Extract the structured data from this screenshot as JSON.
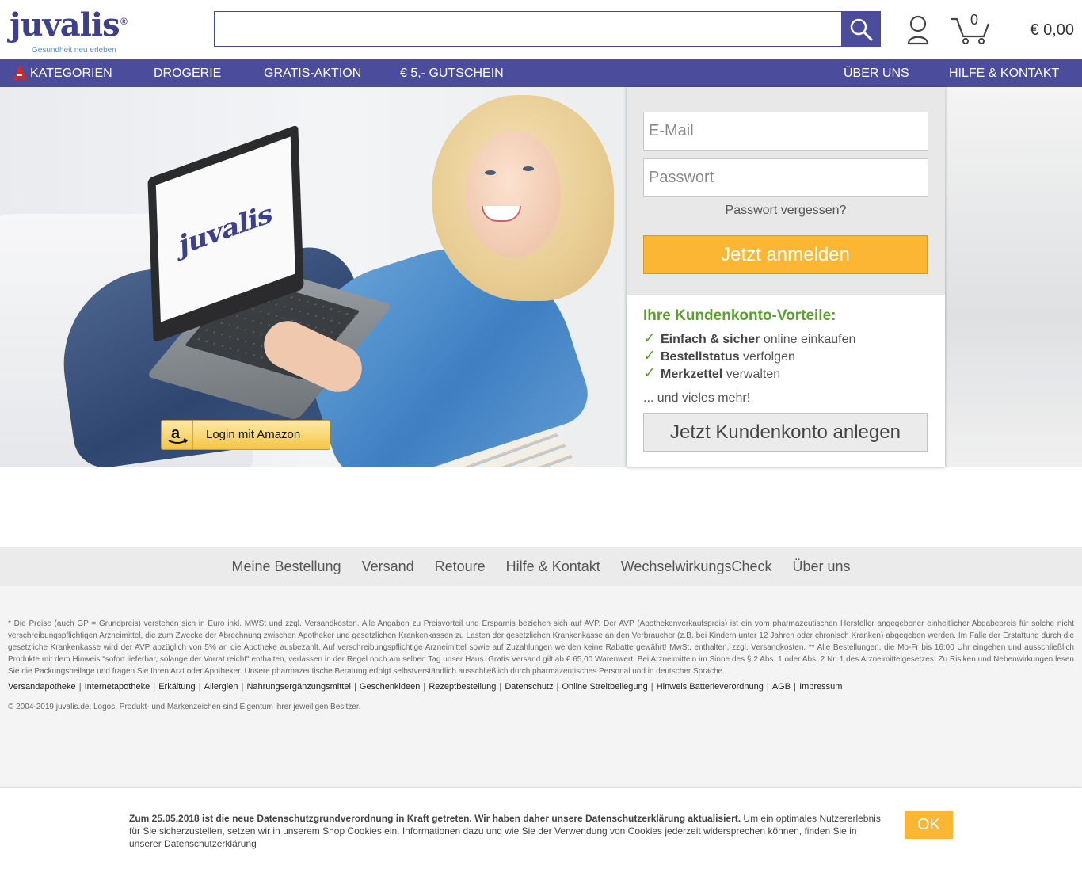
{
  "header": {
    "logo_text": "juvalis",
    "logo_registered": "®",
    "logo_tagline": "Gesundheit neu erleben",
    "search": {
      "value": "",
      "placeholder": ""
    },
    "cart_count": "0",
    "cart_total": "€ 0,00"
  },
  "nav": {
    "items": [
      {
        "label": "Kategorien"
      },
      {
        "label": "Drogerie"
      },
      {
        "label": "Gratis-Aktion"
      },
      {
        "label": "€ 5,- Gutschein"
      },
      {
        "label": "Über uns"
      },
      {
        "label": "Hilfe & Kontakt"
      }
    ]
  },
  "hero": {
    "laptop_logo": "juvalis",
    "amazon_login": "Login mit Amazon"
  },
  "login": {
    "email_placeholder": "E-Mail",
    "password_placeholder": "Passwort",
    "forgot": "Passwort vergessen?",
    "submit": "Jetzt anmelden",
    "benefits_title": "Ihre Kundenkonto-Vorteile:",
    "benefits": [
      {
        "bold": "Einfach & sicher",
        "rest": " online einkaufen"
      },
      {
        "bold": "Bestellstatus",
        "rest": " verfolgen"
      },
      {
        "bold": "Merkzettel",
        "rest": " verwalten"
      }
    ],
    "more": "... und vieles mehr!",
    "register": "Jetzt Kundenkonto anlegen"
  },
  "footer": {
    "links": [
      "Meine Bestellung",
      "Versand",
      "Retoure",
      "Hilfe & Kontakt",
      "WechselwirkungsCheck",
      "Über uns"
    ],
    "legal_text": "* Die Preise (auch GP = Grundpreis) verstehen sich in Euro inkl. MWSt und zzgl. Versandkosten. Alle Angaben zu Preisvorteil und Ersparnis beziehen sich auf AVP. Der AVP (Apothekenverkaufspreis) ist ein vom pharmazeutischen Hersteller angegebener einheitlicher Abgabepreis für solche nicht verschreibungspflichtigen Arzneimittel, die zum Zwecke der Abrechnung zwischen Apotheker und gesetzlichen Krankenkassen zu Lasten der gesetzlichen Krankenkasse an den Verbraucher (z.B. bei Kindern unter 12 Jahren oder chronisch Kranken) abgegeben werden. Im Falle der Erstattung durch die gesetzliche Krankenkasse wird der AVP abzüglich von 5% an die Apotheke ausbezahlt. Auf verschreibungspflichtige Arzneimittel sowie auf Zuzahlungen werden keine Rabatte gewährt! MwSt. enthalten, zzgl. Versandkosten. ** Alle Bestellungen, die Mo-Fr bis 16:00 Uhr eingehen und ausschließlich Produkte mit dem Hinweis \"sofort lieferbar, solange der Vorrat reicht\" enthalten, verlassen in der Regel noch am selben Tag unser Haus. Gratis Versand gilt ab € 65,00 Warenwert. Bei Arzneimitteln im Sinne des § 2 Abs. 1 oder Abs. 2 Nr. 1 des Arzneimittelgesetzes: Zu Risiken und Nebenwirkungen lesen Sie die Packungsbeilage und fragen Sie Ihren Arzt oder Apotheker. Unsere pharmazeutische Beratung erfolgt selbstverständlich ausschließlich durch pharmazeutisches Personal und in deutscher Sprache.",
    "legal_links": [
      "Versandapotheke",
      "Internetapotheke",
      "Erkältung",
      "Allergien",
      "Nahrungsergänzungsmittel",
      "Geschenkideen",
      "Rezeptbestellung",
      "Datenschutz",
      "Online Streitbeilegung",
      "Hinweis Batterieverordnung",
      "AGB",
      "Impressum"
    ],
    "copyright": "© 2004-2019 juvalis.de; Logos, Produkt- und Markenzeichen sind Eigentum ihrer jeweiligen Besitzer."
  },
  "cookie": {
    "bold": "Zum 25.05.2018 ist die neue Datenschutzgrundverordnung in Kraft getreten. Wir haben daher unsere Datenschutzerklärung aktualisiert.",
    "text": " Um ein optimales Nutzererlebnis für Sie sicherzustellen, setzen wir in unserem Shop Cookies ein. Informationen dazu und wie Sie der Verwendung von Cookies jederzeit widersprechen können, finden Sie in unserer ",
    "link": "Datenschutzerklärung",
    "ok": "OK"
  },
  "colors": {
    "brand": "#4b4c9c",
    "accent_orange": "#fbb733",
    "green": "#5aa02c"
  }
}
